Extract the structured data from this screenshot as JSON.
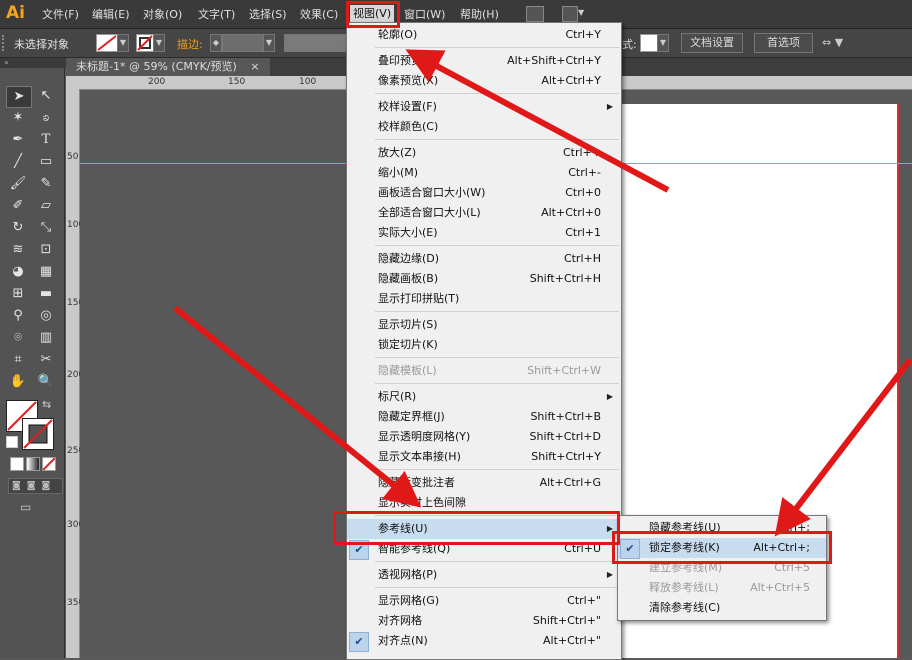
{
  "app": {
    "logo": "Ai"
  },
  "menubar": {
    "items": [
      "文件(F)",
      "编辑(E)",
      "对象(O)",
      "文字(T)",
      "选择(S)",
      "效果(C)",
      "视图(V)",
      "窗口(W)",
      "帮助(H)"
    ]
  },
  "control_bar": {
    "selection_text": "未选择对象",
    "stroke_label": "描边:",
    "style_label": "式:",
    "document_setup": "文档设置",
    "preferences": "首选项"
  },
  "document_tab": {
    "title": "未标题-1* @ 59% (CMYK/预览)",
    "close": "×"
  },
  "ruler": {
    "h_labels": [
      "200",
      "150",
      "100"
    ],
    "v_labels": [
      "50",
      "100",
      "150",
      "200",
      "250",
      "300",
      "350"
    ]
  },
  "view_menu": {
    "groups": [
      [
        {
          "label": "轮廓(O)",
          "shortcut": "Ctrl+Y"
        }
      ],
      [
        {
          "label": "叠印预览(V)",
          "shortcut": "Alt+Shift+Ctrl+Y"
        },
        {
          "label": "像素预览(X)",
          "shortcut": "Alt+Ctrl+Y"
        }
      ],
      [
        {
          "label": "校样设置(F)",
          "submenu": true
        },
        {
          "label": "校样颜色(C)"
        }
      ],
      [
        {
          "label": "放大(Z)",
          "shortcut": "Ctrl++"
        },
        {
          "label": "缩小(M)",
          "shortcut": "Ctrl+-"
        },
        {
          "label": "画板适合窗口大小(W)",
          "shortcut": "Ctrl+0"
        },
        {
          "label": "全部适合窗口大小(L)",
          "shortcut": "Alt+Ctrl+0"
        },
        {
          "label": "实际大小(E)",
          "shortcut": "Ctrl+1"
        }
      ],
      [
        {
          "label": "隐藏边缘(D)",
          "shortcut": "Ctrl+H"
        },
        {
          "label": "隐藏画板(B)",
          "shortcut": "Shift+Ctrl+H"
        },
        {
          "label": "显示打印拼贴(T)"
        }
      ],
      [
        {
          "label": "显示切片(S)"
        },
        {
          "label": "锁定切片(K)"
        }
      ],
      [
        {
          "label": "隐藏模板(L)",
          "shortcut": "Shift+Ctrl+W",
          "disabled": true
        }
      ],
      [
        {
          "label": "标尺(R)",
          "submenu": true
        },
        {
          "label": "隐藏定界框(J)",
          "shortcut": "Shift+Ctrl+B"
        },
        {
          "label": "显示透明度网格(Y)",
          "shortcut": "Shift+Ctrl+D"
        },
        {
          "label": "显示文本串接(H)",
          "shortcut": "Shift+Ctrl+Y"
        }
      ],
      [
        {
          "label": "隐藏渐变批注者",
          "shortcut": "Alt+Ctrl+G"
        },
        {
          "label": "显示实时上色间隙"
        }
      ],
      [
        {
          "label": "参考线(U)",
          "submenu": true,
          "highlighted": true
        },
        {
          "label": "智能参考线(Q)",
          "shortcut": "Ctrl+U",
          "checked": true
        }
      ],
      [
        {
          "label": "透视网格(P)",
          "submenu": true
        }
      ],
      [
        {
          "label": "显示网格(G)",
          "shortcut": "Ctrl+\""
        },
        {
          "label": "对齐网格",
          "shortcut": "Shift+Ctrl+\""
        },
        {
          "label": "对齐点(N)",
          "shortcut": "Alt+Ctrl+\"",
          "checked": true
        }
      ]
    ]
  },
  "guides_submenu": {
    "items": [
      {
        "label": "隐藏参考线(U)",
        "shortcut": "Ctrl+;"
      },
      {
        "label": "锁定参考线(K)",
        "shortcut": "Alt+Ctrl+;",
        "checked": true,
        "highlighted": true
      },
      {
        "label": "建立参考线(M)",
        "shortcut": "Ctrl+5",
        "disabled": true
      },
      {
        "label": "释放参考线(L)",
        "shortcut": "Alt+Ctrl+5",
        "disabled": true
      },
      {
        "label": "清除参考线(C)"
      }
    ]
  },
  "colors": {
    "annotation_red": "#e01818",
    "guide_cyan": "#3ec9c9",
    "menu_highlight": "#c8dcf0"
  }
}
